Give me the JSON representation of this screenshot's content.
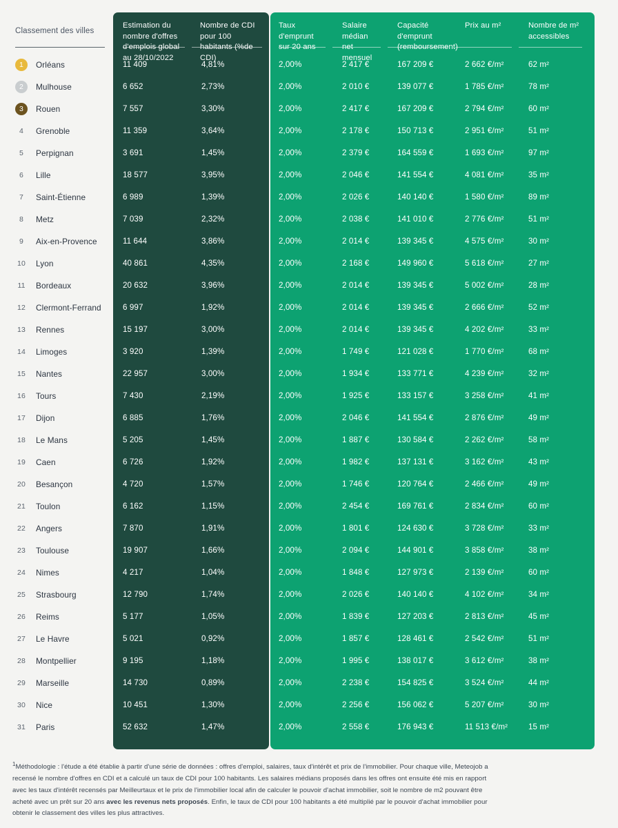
{
  "headers": {
    "rank": "Classement des villes",
    "offers": "Estimation du nombre d'offres d'emplois global au 28/10/2022",
    "cdi": "Nombre de CDI pour 100 habitants (%de CDI)",
    "rate": "Taux d'emprunt sur 20 ans",
    "salary": "Salaire médian net mensuel",
    "capacity": "Capacité d'emprunt (remboursement)",
    "price_m2": "Prix au m²",
    "m2_access": "Nombre de m² accessibles"
  },
  "colors": {
    "background": "#f4f4f2",
    "panel_dark": "#1f4a3f",
    "panel_green": "#0da271",
    "gold": "#e8b93c",
    "silver": "#c9cdcf",
    "bronze": "#6c531f",
    "text": "#2b3440"
  },
  "rows": [
    {
      "rank": "1",
      "medal": "gold",
      "city": "Orléans",
      "offers": "11 409",
      "cdi": "4,81%",
      "rate": "2,00%",
      "salary": "2 417 €",
      "capacity": "167 209 €",
      "price_m2": "2 662 €/m²",
      "m2_access": "62 m²"
    },
    {
      "rank": "2",
      "medal": "silver",
      "city": "Mulhouse",
      "offers": "6 652",
      "cdi": "2,73%",
      "rate": "2,00%",
      "salary": "2 010 €",
      "capacity": "139 077 €",
      "price_m2": "1 785 €/m²",
      "m2_access": "78 m²"
    },
    {
      "rank": "3",
      "medal": "bronze",
      "city": "Rouen",
      "offers": "7 557",
      "cdi": "3,30%",
      "rate": "2,00%",
      "salary": "2 417 €",
      "capacity": "167 209 €",
      "price_m2": "2 794 €/m²",
      "m2_access": "60 m²"
    },
    {
      "rank": "4",
      "medal": "plain",
      "city": "Grenoble",
      "offers": "11 359",
      "cdi": "3,64%",
      "rate": "2,00%",
      "salary": "2 178 €",
      "capacity": "150 713 €",
      "price_m2": "2 951 €/m²",
      "m2_access": "51 m²"
    },
    {
      "rank": "5",
      "medal": "plain",
      "city": "Perpignan",
      "offers": "3 691",
      "cdi": "1,45%",
      "rate": "2,00%",
      "salary": "2 379 €",
      "capacity": "164 559 €",
      "price_m2": "1 693 €/m²",
      "m2_access": "97 m²"
    },
    {
      "rank": "6",
      "medal": "plain",
      "city": "Lille",
      "offers": "18 577",
      "cdi": "3,95%",
      "rate": "2,00%",
      "salary": "2 046 €",
      "capacity": "141 554 €",
      "price_m2": "4 081 €/m²",
      "m2_access": "35 m²"
    },
    {
      "rank": "7",
      "medal": "plain",
      "city": "Saint-Étienne",
      "offers": "6 989",
      "cdi": "1,39%",
      "rate": "2,00%",
      "salary": "2 026 €",
      "capacity": "140 140 €",
      "price_m2": "1 580 €/m²",
      "m2_access": "89 m²"
    },
    {
      "rank": "8",
      "medal": "plain",
      "city": "Metz",
      "offers": "7 039",
      "cdi": "2,32%",
      "rate": "2,00%",
      "salary": "2 038 €",
      "capacity": "141 010 €",
      "price_m2": "2 776 €/m²",
      "m2_access": "51 m²"
    },
    {
      "rank": "9",
      "medal": "plain",
      "city": "Aix-en-Provence",
      "offers": "11 644",
      "cdi": "3,86%",
      "rate": "2,00%",
      "salary": "2 014 €",
      "capacity": "139 345 €",
      "price_m2": "4 575 €/m²",
      "m2_access": "30 m²"
    },
    {
      "rank": "10",
      "medal": "plain",
      "city": "Lyon",
      "offers": "40 861",
      "cdi": "4,35%",
      "rate": "2,00%",
      "salary": "2 168 €",
      "capacity": "149 960 €",
      "price_m2": "5 618 €/m²",
      "m2_access": "27 m²"
    },
    {
      "rank": "11",
      "medal": "plain",
      "city": "Bordeaux",
      "offers": "20 632",
      "cdi": "3,96%",
      "rate": "2,00%",
      "salary": "2 014 €",
      "capacity": "139 345 €",
      "price_m2": "5 002 €/m²",
      "m2_access": "28 m²"
    },
    {
      "rank": "12",
      "medal": "plain",
      "city": "Clermont-Ferrand",
      "offers": "6 997",
      "cdi": "1,92%",
      "rate": "2,00%",
      "salary": "2 014 €",
      "capacity": "139 345 €",
      "price_m2": "2 666 €/m²",
      "m2_access": "52 m²"
    },
    {
      "rank": "13",
      "medal": "plain",
      "city": "Rennes",
      "offers": "15 197",
      "cdi": "3,00%",
      "rate": "2,00%",
      "salary": "2 014 €",
      "capacity": "139 345 €",
      "price_m2": "4 202 €/m²",
      "m2_access": "33 m²"
    },
    {
      "rank": "14",
      "medal": "plain",
      "city": "Limoges",
      "offers": "3 920",
      "cdi": "1,39%",
      "rate": "2,00%",
      "salary": "1 749 €",
      "capacity": "121 028 €",
      "price_m2": "1 770 €/m²",
      "m2_access": "68 m²"
    },
    {
      "rank": "15",
      "medal": "plain",
      "city": "Nantes",
      "offers": "22 957",
      "cdi": "3,00%",
      "rate": "2,00%",
      "salary": "1 934 €",
      "capacity": "133 771 €",
      "price_m2": "4 239 €/m²",
      "m2_access": "32 m²"
    },
    {
      "rank": "16",
      "medal": "plain",
      "city": "Tours",
      "offers": "7 430",
      "cdi": "2,19%",
      "rate": "2,00%",
      "salary": "1 925 €",
      "capacity": "133 157 €",
      "price_m2": "3 258 €/m²",
      "m2_access": "41 m²"
    },
    {
      "rank": "17",
      "medal": "plain",
      "city": "Dijon",
      "offers": "6 885",
      "cdi": "1,76%",
      "rate": "2,00%",
      "salary": "2 046 €",
      "capacity": "141 554 €",
      "price_m2": "2 876 €/m²",
      "m2_access": "49 m²"
    },
    {
      "rank": "18",
      "medal": "plain",
      "city": "Le Mans",
      "offers": "5 205",
      "cdi": "1,45%",
      "rate": "2,00%",
      "salary": "1 887 €",
      "capacity": "130 584 €",
      "price_m2": "2 262 €/m²",
      "m2_access": "58 m²"
    },
    {
      "rank": "19",
      "medal": "plain",
      "city": "Caen",
      "offers": "6 726",
      "cdi": "1,92%",
      "rate": "2,00%",
      "salary": "1 982 €",
      "capacity": "137 131 €",
      "price_m2": "3 162 €/m²",
      "m2_access": "43 m²"
    },
    {
      "rank": "20",
      "medal": "plain",
      "city": "Besançon",
      "offers": "4 720",
      "cdi": "1,57%",
      "rate": "2,00%",
      "salary": "1 746 €",
      "capacity": "120 764 €",
      "price_m2": "2 466 €/m²",
      "m2_access": "49 m²"
    },
    {
      "rank": "21",
      "medal": "plain",
      "city": "Toulon",
      "offers": "6 162",
      "cdi": "1,15%",
      "rate": "2,00%",
      "salary": "2 454 €",
      "capacity": "169 761 €",
      "price_m2": "2 834 €/m²",
      "m2_access": "60 m²"
    },
    {
      "rank": "22",
      "medal": "plain",
      "city": "Angers",
      "offers": "7 870",
      "cdi": "1,91%",
      "rate": "2,00%",
      "salary": "1 801 €",
      "capacity": "124 630 €",
      "price_m2": "3 728 €/m²",
      "m2_access": "33 m²"
    },
    {
      "rank": "23",
      "medal": "plain",
      "city": "Toulouse",
      "offers": "19 907",
      "cdi": "1,66%",
      "rate": "2,00%",
      "salary": "2 094 €",
      "capacity": "144 901 €",
      "price_m2": "3 858 €/m²",
      "m2_access": "38 m²"
    },
    {
      "rank": "24",
      "medal": "plain",
      "city": "Nimes",
      "offers": "4 217",
      "cdi": "1,04%",
      "rate": "2,00%",
      "salary": "1 848 €",
      "capacity": "127 973 €",
      "price_m2": "2 139 €/m²",
      "m2_access": "60 m²"
    },
    {
      "rank": "25",
      "medal": "plain",
      "city": "Strasbourg",
      "offers": "12 790",
      "cdi": "1,74%",
      "rate": "2,00%",
      "salary": "2 026 €",
      "capacity": "140 140 €",
      "price_m2": "4 102 €/m²",
      "m2_access": "34 m²"
    },
    {
      "rank": "26",
      "medal": "plain",
      "city": "Reims",
      "offers": "5 177",
      "cdi": "1,05%",
      "rate": "2,00%",
      "salary": "1 839 €",
      "capacity": "127 203 €",
      "price_m2": "2 813 €/m²",
      "m2_access": "45 m²"
    },
    {
      "rank": "27",
      "medal": "plain",
      "city": "Le Havre",
      "offers": "5 021",
      "cdi": "0,92%",
      "rate": "2,00%",
      "salary": "1 857 €",
      "capacity": "128 461 €",
      "price_m2": "2 542 €/m²",
      "m2_access": "51 m²"
    },
    {
      "rank": "28",
      "medal": "plain",
      "city": "Montpellier",
      "offers": "9 195",
      "cdi": "1,18%",
      "rate": "2,00%",
      "salary": "1 995 €",
      "capacity": "138 017 €",
      "price_m2": "3 612 €/m²",
      "m2_access": "38 m²"
    },
    {
      "rank": "29",
      "medal": "plain",
      "city": "Marseille",
      "offers": "14 730",
      "cdi": "0,89%",
      "rate": "2,00%",
      "salary": "2 238 €",
      "capacity": "154 825 €",
      "price_m2": "3 524 €/m²",
      "m2_access": "44 m²"
    },
    {
      "rank": "30",
      "medal": "plain",
      "city": "Nice",
      "offers": "10 451",
      "cdi": "1,30%",
      "rate": "2,00%",
      "salary": "2 256 €",
      "capacity": "156 062 €",
      "price_m2": "5 207 €/m²",
      "m2_access": "30 m²"
    },
    {
      "rank": "31",
      "medal": "plain",
      "city": "Paris",
      "offers": "52 632",
      "cdi": "1,47%",
      "rate": "2,00%",
      "salary": "2 558 €",
      "capacity": "176 943 €",
      "price_m2": "11 513 €/m²",
      "m2_access": "15 m²"
    }
  ],
  "footnote": {
    "marker": "1",
    "part1": "Méthodologie : l'étude a été établie à partir d'une série de données : offres d'emploi, salaires, taux d'intérêt et prix de l'immobilier. Pour chaque ville, Meteojob a recensé le nombre d'offres en CDI et a calculé un taux de CDI pour 100 habitants. Les salaires médians proposés dans les offres ont ensuite été mis en rapport avec les taux d'intérêt recensés par Meilleurtaux et le prix de l'immobilier local afin de calculer le pouvoir d'achat immobilier, soit le nombre de m2 pouvant être acheté avec un prêt sur 20 ans ",
    "bold": "avec les revenus nets proposés",
    "part2": ". Enfin, le taux de CDI pour 100 habitants a été multiplié par le pouvoir d'achat immobilier pour obtenir le classement des villes les plus attractives."
  }
}
